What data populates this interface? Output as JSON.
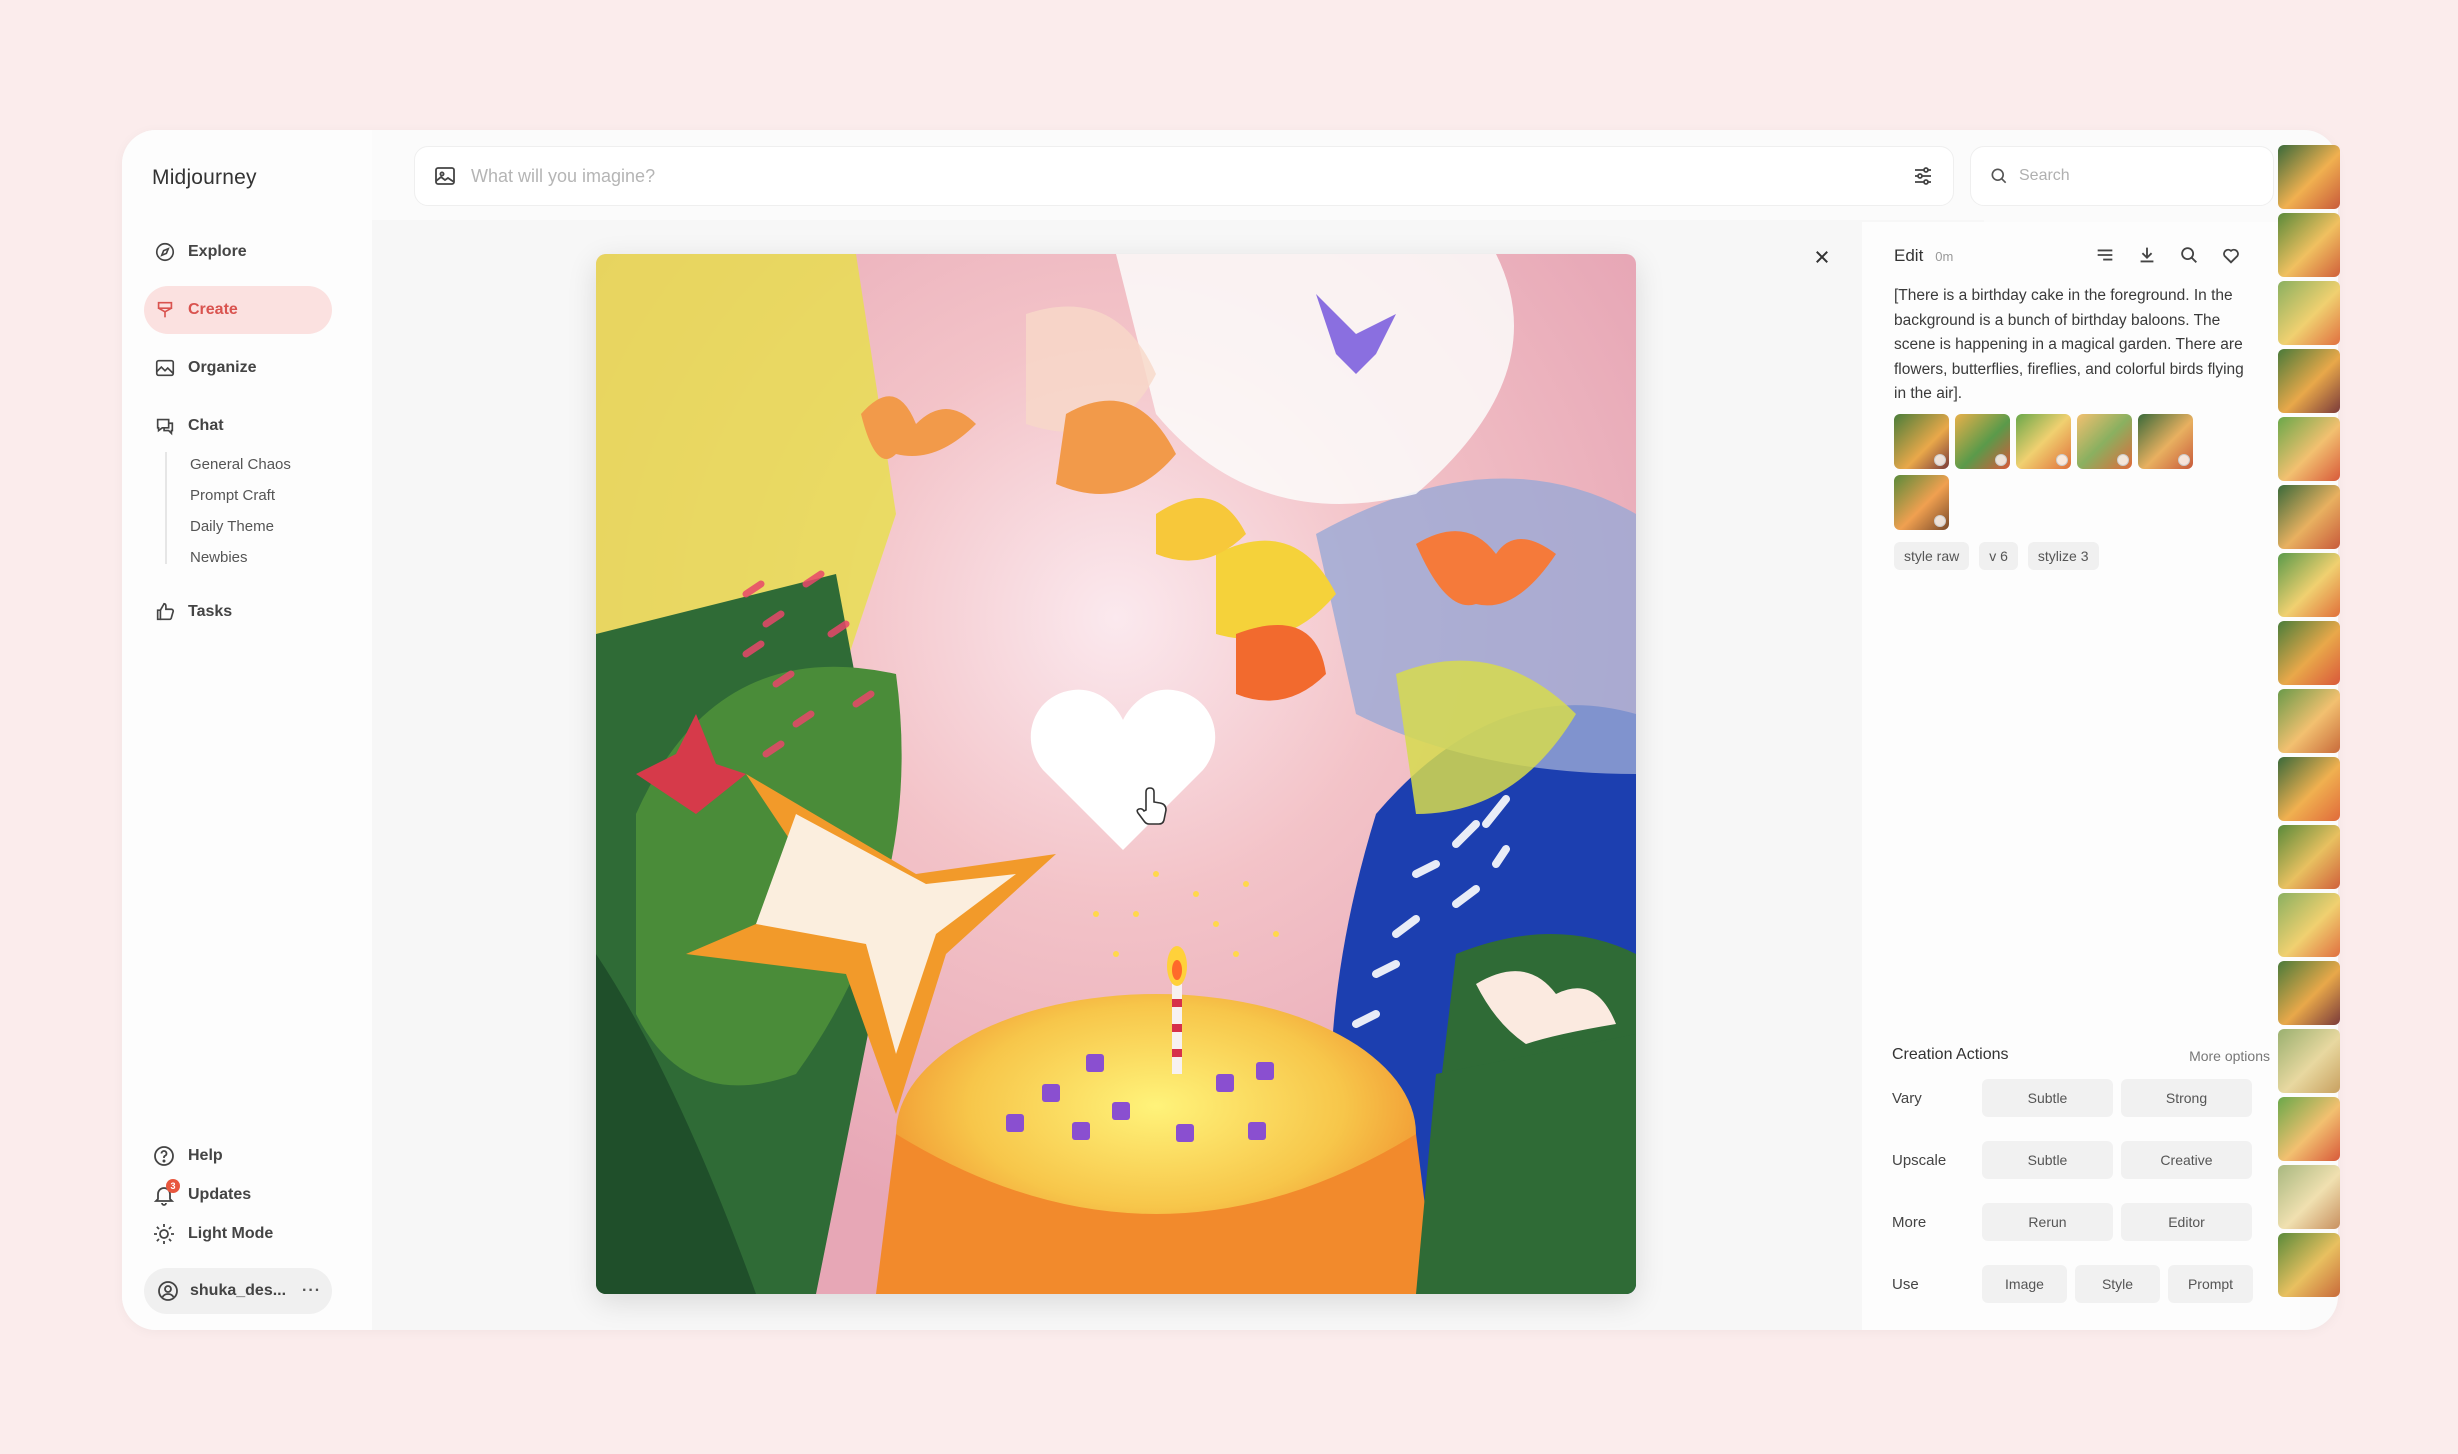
{
  "app": {
    "name": "Midjourney"
  },
  "sidebar": {
    "nav": [
      {
        "label": "Explore",
        "icon": "compass-icon"
      },
      {
        "label": "Create",
        "icon": "brush-icon",
        "active": true
      },
      {
        "label": "Organize",
        "icon": "image-icon"
      },
      {
        "label": "Chat",
        "icon": "chat-icon"
      }
    ],
    "chat_rooms": [
      "General Chaos",
      "Prompt Craft",
      "Daily Theme",
      "Newbies"
    ],
    "tasks": {
      "label": "Tasks",
      "icon": "thumbs-up-icon"
    },
    "bottom": {
      "help": "Help",
      "updates": "Updates",
      "updates_badge": "3",
      "light_mode": "Light Mode"
    },
    "user": {
      "name": "shuka_des...",
      "more": "···"
    }
  },
  "topbar": {
    "imagine_placeholder": "What will you imagine?",
    "search_placeholder": "Search"
  },
  "panel": {
    "edit_label": "Edit",
    "time_ago": "0m",
    "prompt": "[There is a birthday cake in the foreground. In the background is a bunch of birthday baloons. The scene is happening in a magical garden. There are flowers, butterflies, fireflies, and colorful birds flying in the air].",
    "tags": [
      "style raw",
      "v 6",
      "stylize 3"
    ],
    "actions_title": "Creation Actions",
    "more_options": "More options",
    "actions": {
      "vary": {
        "label": "Vary",
        "buttons": [
          "Subtle",
          "Strong"
        ]
      },
      "upscale": {
        "label": "Upscale",
        "buttons": [
          "Subtle",
          "Creative"
        ]
      },
      "more": {
        "label": "More",
        "buttons": [
          "Rerun",
          "Editor"
        ]
      },
      "use": {
        "label": "Use",
        "buttons": [
          "Image",
          "Style",
          "Prompt"
        ]
      }
    }
  },
  "colors": {
    "accent": "#d9534f",
    "accent_bg": "#fbe1e0",
    "page_bg": "#fbecec"
  }
}
